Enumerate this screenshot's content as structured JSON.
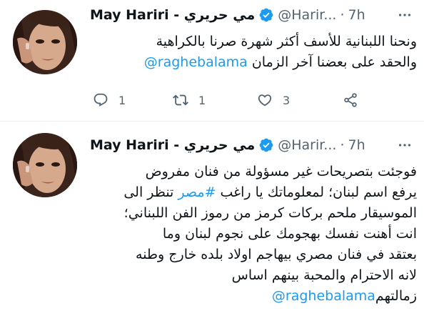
{
  "tweets": [
    {
      "author": {
        "name": "May Hariri - مي حريري",
        "handle": "@Harir...",
        "verified": true,
        "avatar_icon": "profile-photo"
      },
      "time": "7h",
      "separator": "·",
      "text_lines": [
        "ونحنا اللبنانية للأسف أكثر شهرة صرنا بالكراهية",
        "والحقد على بعضنا  آخر الزمان"
      ],
      "mention": "@raghebalama",
      "actions": {
        "reply_count": "1",
        "retweet_count": "1",
        "like_count": "3",
        "share_icon": "share-icon"
      }
    },
    {
      "author": {
        "name": "May Hariri - مي حريري",
        "handle": "@Harir...",
        "verified": true,
        "avatar_icon": "profile-photo"
      },
      "time": "7h",
      "separator": "·",
      "text_lines": [
        "فوجئت بتصريحات غير مسؤولة من فنان مفروض",
        "يرفع اسم لبنان؛ لمعلوماتك يا راغب",
        "الموسيقار ملحم بركات كرمز من رموز الفن اللبناني؛",
        "انت أهنت نفسك بهجومك على نجوم لبنان وما",
        "بعتقد في فنان مصري بيهاجم اولاد بلده خارج وطنه",
        "لانه الاحترام والمحبة بينهم اساس",
        "زمالتهم"
      ],
      "hashtag": "#مصر",
      "hashtag_suffix": "تنظر الى",
      "mention": "@raghebalama"
    }
  ],
  "colors": {
    "accent": "#1d9bf0",
    "text": "#0f1419",
    "muted": "#536471",
    "divider": "#eff3f4"
  }
}
